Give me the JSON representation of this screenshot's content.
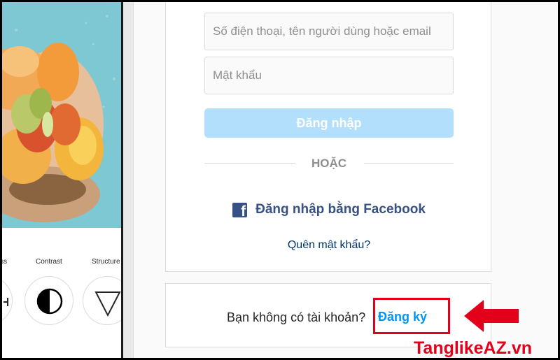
{
  "login": {
    "username_placeholder": "Số điện thoại, tên người dùng hoặc email",
    "password_placeholder": "Mật khẩu",
    "login_button": "Đăng nhập",
    "divider": "HOẶC",
    "facebook_login": "Đăng nhập bằng Facebook",
    "forgot_password": "Quên mật khẩu?"
  },
  "signup": {
    "prompt": "Bạn không có tài khoản?",
    "link": "Đăng ký"
  },
  "phone_preview": {
    "filters": [
      "ss",
      "Contrast",
      "Structure"
    ]
  },
  "watermark": "TanglikeAZ.vn",
  "colors": {
    "login_button": "#b2dffc",
    "link_blue": "#0095f6",
    "facebook_blue": "#385185",
    "highlight_red": "#e3001b"
  }
}
